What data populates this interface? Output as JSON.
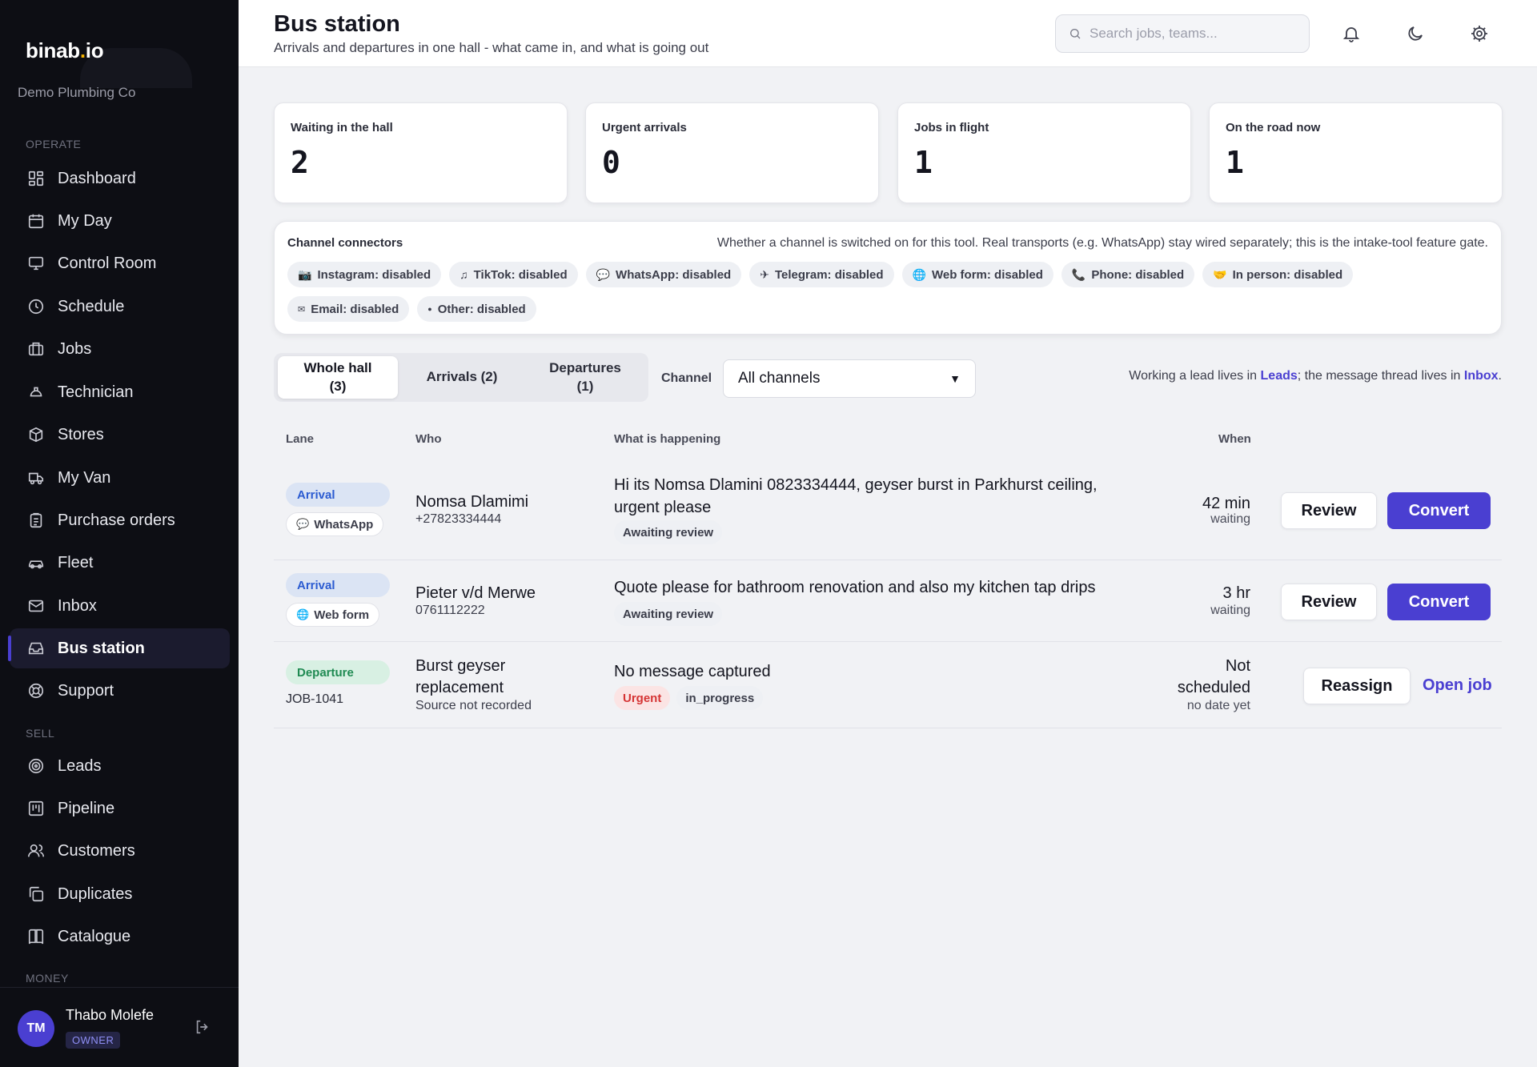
{
  "brand": {
    "name_part1": "binab",
    "dot": ".",
    "name_part2": "io",
    "company": "Demo Plumbing Co"
  },
  "sidebar": {
    "section_operate": "OPERATE",
    "section_sell": "SELL",
    "section_money": "MONEY",
    "items": [
      {
        "label": "Dashboard",
        "icon": "dashboard-icon"
      },
      {
        "label": "My Day",
        "icon": "calendar-icon"
      },
      {
        "label": "Control Room",
        "icon": "monitor-icon"
      },
      {
        "label": "Schedule",
        "icon": "clock-icon"
      },
      {
        "label": "Jobs",
        "icon": "briefcase-icon"
      },
      {
        "label": "Technician",
        "icon": "hard-hat-icon"
      },
      {
        "label": "Stores",
        "icon": "box-icon"
      },
      {
        "label": "My Van",
        "icon": "truck-icon"
      },
      {
        "label": "Purchase orders",
        "icon": "clipboard-icon"
      },
      {
        "label": "Fleet",
        "icon": "car-icon"
      },
      {
        "label": "Inbox",
        "icon": "mail-icon"
      },
      {
        "label": "Bus station",
        "icon": "inbox-tray-icon",
        "active": true
      },
      {
        "label": "Support",
        "icon": "lifebuoy-icon"
      },
      {
        "label": "Leads",
        "icon": "target-icon"
      },
      {
        "label": "Pipeline",
        "icon": "kanban-icon"
      },
      {
        "label": "Customers",
        "icon": "users-icon"
      },
      {
        "label": "Duplicates",
        "icon": "copy-icon"
      },
      {
        "label": "Catalogue",
        "icon": "book-icon"
      }
    ]
  },
  "user": {
    "initials": "TM",
    "name": "Thabo Molefe",
    "role": "OWNER"
  },
  "header": {
    "title": "Bus station",
    "subtitle": "Arrivals and departures in one hall - what came in, and what is going out",
    "search_placeholder": "Search jobs, teams..."
  },
  "stats": [
    {
      "label": "Waiting in the hall",
      "value": "2"
    },
    {
      "label": "Urgent arrivals",
      "value": "0"
    },
    {
      "label": "Jobs in flight",
      "value": "1"
    },
    {
      "label": "On the road now",
      "value": "1"
    }
  ],
  "connectors": {
    "title": "Channel connectors",
    "note": "Whether a channel is switched on for this tool. Real transports (e.g. WhatsApp) stay wired separately; this is the intake-tool feature gate.",
    "chips": [
      {
        "icon": "📷",
        "label": "Instagram: disabled"
      },
      {
        "icon": "♫",
        "label": "TikTok: disabled"
      },
      {
        "icon": "💬",
        "label": "WhatsApp: disabled"
      },
      {
        "icon": "✈",
        "label": "Telegram: disabled"
      },
      {
        "icon": "🌐",
        "label": "Web form: disabled"
      },
      {
        "icon": "📞",
        "label": "Phone: disabled"
      },
      {
        "icon": "🤝",
        "label": "In person: disabled"
      },
      {
        "icon": "✉",
        "label": "Email: disabled"
      },
      {
        "icon": "●",
        "label": "Other: disabled"
      }
    ]
  },
  "tabs": {
    "whole_hall_line1": "Whole hall",
    "whole_hall_line2": "(3)",
    "arrivals": "Arrivals (2)",
    "departures_line1": "Departures",
    "departures_line2": "(1)"
  },
  "filter": {
    "label": "Channel",
    "selected": "All channels"
  },
  "hint": {
    "prefix": "Working a lead lives in ",
    "leads_link": "Leads",
    "middle": "; the message thread lives in ",
    "inbox_link": "Inbox",
    "suffix": "."
  },
  "table": {
    "headers": {
      "lane": "Lane",
      "who": "Who",
      "what": "What is happening",
      "when": "When"
    },
    "rows": [
      {
        "lane": "Arrival",
        "source_icon": "💬",
        "source": "WhatsApp",
        "name": "Nomsa Dlamimi",
        "sub": "+27823334444",
        "message": "Hi its Nomsa Dlamini 0823334444, geyser burst in Parkhurst ceiling, urgent please",
        "tags": [
          "Awaiting review"
        ],
        "when_main": "42 min",
        "when_sub": "waiting",
        "action1": "Review",
        "action2": "Convert"
      },
      {
        "lane": "Arrival",
        "source_icon": "🌐",
        "source": "Web form",
        "name": "Pieter v/d Merwe",
        "sub": "0761112222",
        "message": "Quote please for bathroom renovation and also my kitchen tap drips",
        "tags": [
          "Awaiting review"
        ],
        "when_main": "3 hr",
        "when_sub": "waiting",
        "action1": "Review",
        "action2": "Convert"
      },
      {
        "lane": "Departure",
        "job_ref": "JOB-1041",
        "name_line1": "Burst geyser",
        "name_line2": "replacement",
        "sub": "Source not recorded",
        "message": "No message captured",
        "tags": [
          "Urgent",
          "in_progress"
        ],
        "when_line1": "Not",
        "when_line2": "scheduled",
        "when_sub": "no date yet",
        "action1": "Reassign",
        "action2": "Open job"
      }
    ]
  },
  "colors": {
    "accent": "#4a3fd1",
    "sidebar_bg": "#0d0e14",
    "arrival": "#2b5bd1",
    "departure": "#1f8a52",
    "urgent": "#d53434"
  }
}
